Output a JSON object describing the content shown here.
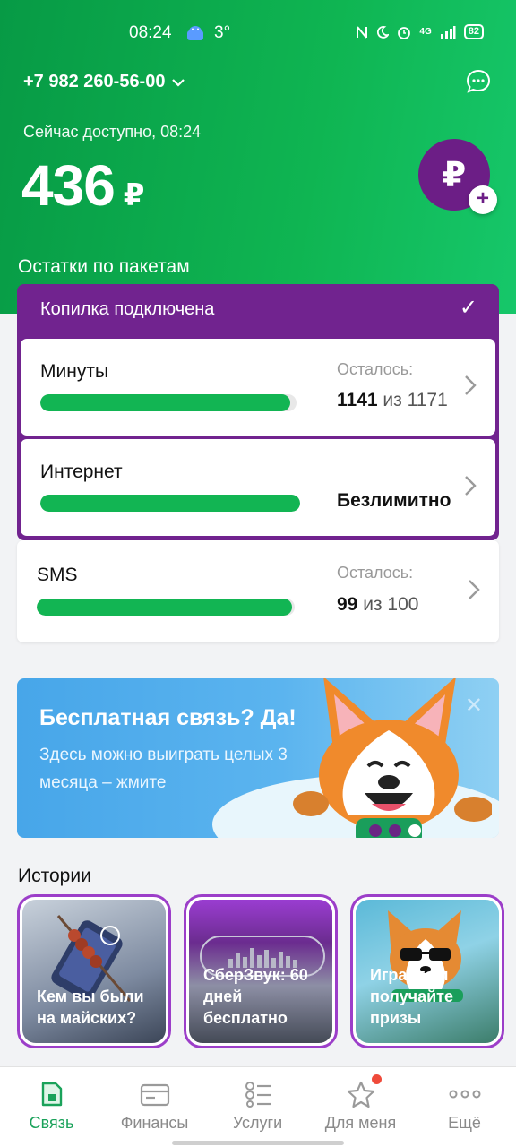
{
  "status_bar": {
    "time": "08:24",
    "temperature": "3°",
    "network": "4G",
    "battery": "82"
  },
  "header": {
    "phone": "+7 982 260-56-00",
    "available_label": "Сейчас доступно, 08:24",
    "balance": "436",
    "currency": "₽",
    "topup_symbol": "₽",
    "topup_plus": "+"
  },
  "packages": {
    "title": "Остатки по пакетам",
    "kopilka": {
      "label": "Копилка подключена",
      "check": "✓"
    },
    "items": [
      {
        "name": "Минуты",
        "remaining_label": "Осталось:",
        "value": "1141",
        "of": "из 1171",
        "fill_fraction": 0.974
      },
      {
        "name": "Интернет",
        "remaining_label": "",
        "value": "Безлимитно",
        "of": "",
        "fill_fraction": 1.0
      },
      {
        "name": "SMS",
        "remaining_label": "Осталось:",
        "value": "99",
        "of": "из 100",
        "fill_fraction": 0.99
      }
    ]
  },
  "promo": {
    "title": "Бесплатная связь? Да!",
    "text": "Здесь можно выиграть целых 3 месяца – жмите",
    "close": "✕"
  },
  "stories": {
    "title": "Истории",
    "items": [
      {
        "label": "Кем вы были на майских?"
      },
      {
        "label": "СберЗвук: 60 дней бесплатно"
      },
      {
        "label": "Играйте и получайте призы"
      }
    ]
  },
  "nav": [
    {
      "label": "Связь",
      "icon": "sim-card-icon",
      "active": true
    },
    {
      "label": "Финансы",
      "icon": "wallet-icon",
      "active": false
    },
    {
      "label": "Услуги",
      "icon": "list-icon",
      "active": false
    },
    {
      "label": "Для меня",
      "icon": "star-icon",
      "active": false,
      "badge": true
    },
    {
      "label": "Ещё",
      "icon": "more-icon",
      "active": false
    }
  ],
  "colors": {
    "green": "#12b553",
    "purple": "#71238f",
    "promo_blue": "#47a6e9"
  }
}
